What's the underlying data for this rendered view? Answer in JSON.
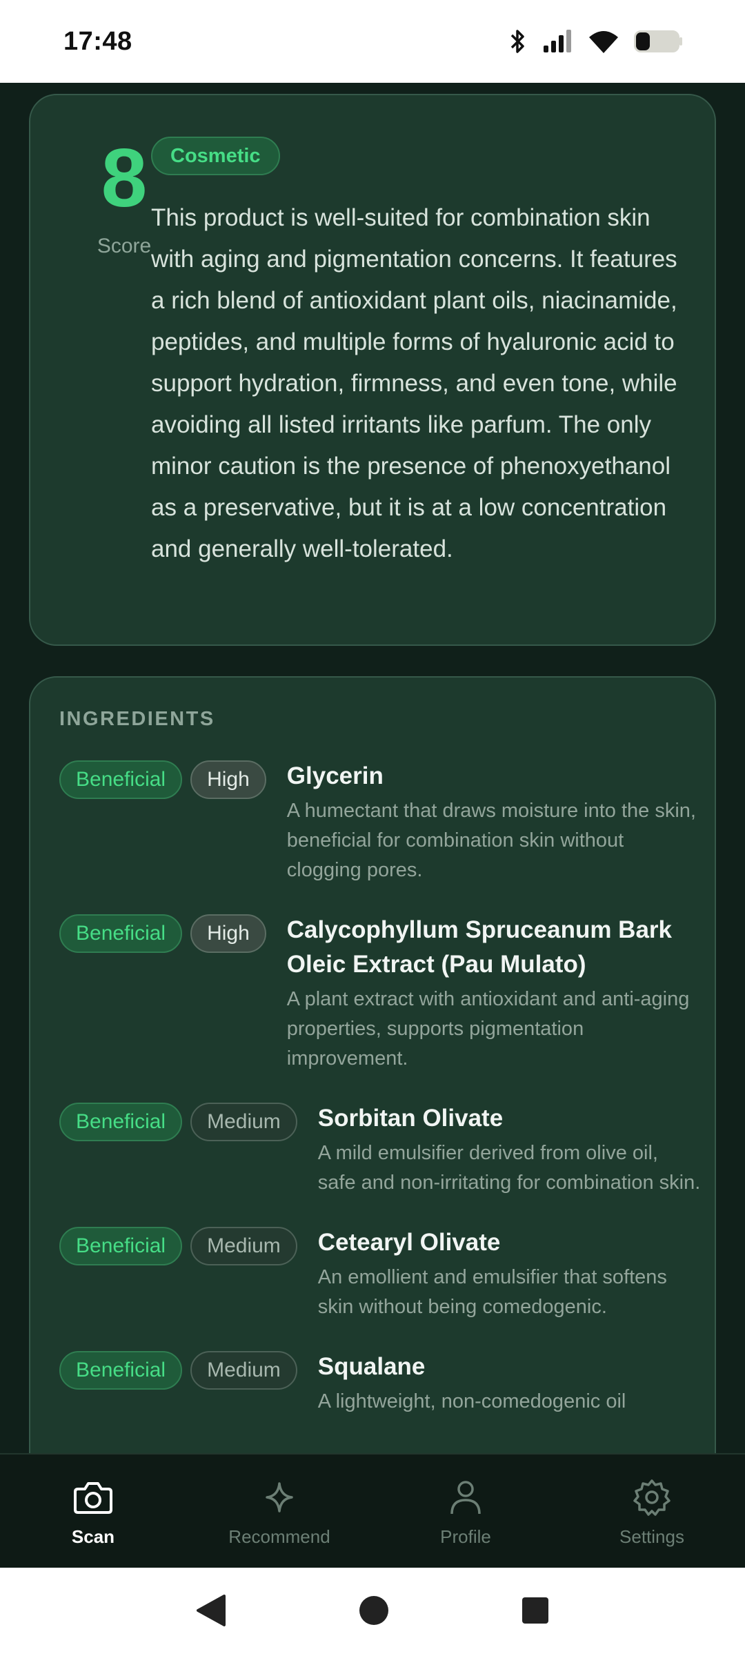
{
  "status_bar": {
    "time": "17:48",
    "icons": [
      "bluetooth-icon",
      "signal-icon",
      "wifi-icon",
      "battery-icon"
    ]
  },
  "summary": {
    "score": "8",
    "score_label": "Score",
    "category": "Cosmetic",
    "text": "This product is well-suited for combination skin with aging and pigmentation concerns. It features a rich blend of antioxidant plant oils, niacinamide, peptides, and multiple forms of hyaluronic acid to support hydration, firmness, and even tone, while avoiding all listed irritants like parfum. The only minor caution is the presence of phenoxyethanol as a preservative, but it is at a low concentration and generally well-tolerated."
  },
  "ingredients": {
    "title": "INGREDIENTS",
    "items": [
      {
        "rating": "Beneficial",
        "level": "High",
        "name": "Glycerin",
        "description": "A humectant that draws moisture into the skin, beneficial for combination skin without clogging pores."
      },
      {
        "rating": "Beneficial",
        "level": "High",
        "name": "Calycophyllum Spruceanum Bark Oleic Extract (Pau Mulato)",
        "description": "A plant extract with antioxidant and anti-aging properties, supports pigmentation improvement."
      },
      {
        "rating": "Beneficial",
        "level": "Medium",
        "name": "Sorbitan Olivate",
        "description": "A mild emulsifier derived from olive oil, safe and non-irritating for combination skin."
      },
      {
        "rating": "Beneficial",
        "level": "Medium",
        "name": "Cetearyl Olivate",
        "description": "An emollient and emulsifier that softens skin without being comedogenic."
      },
      {
        "rating": "Beneficial",
        "level": "Medium",
        "name": "Squalane",
        "description": "A lightweight, non-comedogenic oil"
      }
    ]
  },
  "nav": {
    "items": [
      {
        "label": "Scan",
        "icon": "camera-icon",
        "active": true
      },
      {
        "label": "Recommend",
        "icon": "sparkle-icon",
        "active": false
      },
      {
        "label": "Profile",
        "icon": "person-icon",
        "active": false
      },
      {
        "label": "Settings",
        "icon": "gear-icon",
        "active": false
      }
    ]
  },
  "system_nav": {
    "buttons": [
      "back-icon",
      "home-icon",
      "recents-icon"
    ]
  },
  "colors": {
    "accent": "#3fd27d",
    "background": "#10201a",
    "card": "#1d3a2d"
  }
}
